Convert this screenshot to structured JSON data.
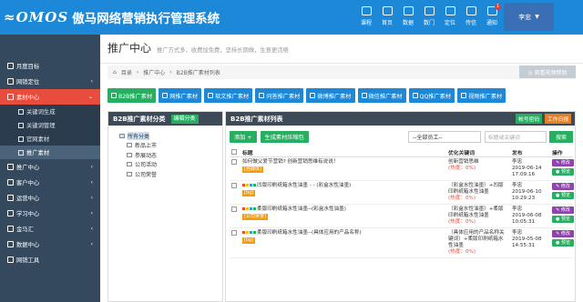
{
  "header": {
    "logo_text": "OMOS",
    "title": "傲马网络营销执行管理系统",
    "nav": [
      {
        "label": "课程",
        "badge": ""
      },
      {
        "label": "首页",
        "badge": ""
      },
      {
        "label": "数据",
        "badge": ""
      },
      {
        "label": "数门",
        "badge": ""
      },
      {
        "label": "定位",
        "badge": ""
      },
      {
        "label": "传信",
        "badge": ""
      },
      {
        "label": "通知",
        "badge": "1"
      }
    ],
    "user": "李忠"
  },
  "sidebar": {
    "items": [
      {
        "label": "月度目标",
        "arrow": ""
      },
      {
        "label": "网销定位",
        "arrow": "‹"
      },
      {
        "label": "素材中心",
        "arrow": "⌄",
        "active": true
      }
    ],
    "sub": [
      {
        "label": "关键词生成"
      },
      {
        "label": "关键词管理"
      },
      {
        "label": "官网素材"
      },
      {
        "label": "推广素材",
        "current": true
      }
    ],
    "rest": [
      {
        "label": "推广中心",
        "arrow": "‹"
      },
      {
        "label": "客户中心",
        "arrow": "‹"
      },
      {
        "label": "运营中心",
        "arrow": "‹"
      },
      {
        "label": "学习中心",
        "arrow": "‹"
      },
      {
        "label": "金马汇",
        "arrow": "‹"
      },
      {
        "label": "数据中心",
        "arrow": "‹"
      },
      {
        "label": "网销工具",
        "arrow": ""
      }
    ]
  },
  "page": {
    "title": "推广中心",
    "subtitle": "推广方式多，收费加免费，坚持长期做，生意更活络",
    "crumb": [
      "目录",
      "推广中心",
      "B2B推广素材列表"
    ],
    "help": "◎ 观看视频帮助"
  },
  "tabs": [
    "B2B推广素材",
    "网推广素材",
    "软文推广素材",
    "问答推广素材",
    "微博推广素材",
    "微信推广素材",
    "QQ推广素材",
    "视频推广素材"
  ],
  "category": {
    "title": "B2B推广素材分类",
    "edit": "编辑分类",
    "root": "所有分类",
    "children": [
      "新品上市",
      "参展动态",
      "公司活动",
      "公司荣誉"
    ]
  },
  "list": {
    "title": "B2B推广素材列表",
    "btn_account": "帐号密码",
    "btn_log": "工作日报",
    "add": "添加 +",
    "gen": "生成素材压缩包",
    "select": "--全部员工--",
    "kw_placeholder": "标题或关键词",
    "search": "搜索",
    "headers": [
      "标题",
      "优化关键词",
      "发布",
      "操作"
    ],
    "rows": [
      {
        "title": "如何做父爱节营销? 创新营销思维有说说！",
        "tag": "[自媒体]",
        "kw": "创新营销思维",
        "degree": "(热度：0%)",
        "author": "李忠",
        "date": "2019-06-14 17:09:16"
      },
      {
        "title": "凹版印刷纸箱水性油墨 - - (彩盒水性油墨)",
        "tag": "[bg]",
        "kw": "（彩盒水性油墨）+凹版印刷纸箱水性油墨",
        "degree": "(热度：0%)",
        "author": "李忠",
        "date": "2019-06-10 10:29:23"
      },
      {
        "title": "柔版印刷纸箱水性油墨--(彩盒水性油墨)",
        "tag": "[公司荣誉]",
        "kw": "（彩盒水性油墨）+柔版印刷纸箱水性油墨",
        "degree": "(热度：0%)",
        "author": "李忠",
        "date": "2019-06-08 10:05:31"
      },
      {
        "title": "柔版印刷纸箱水性油墨--(具体应用的产品名称)",
        "tag": "[bg]",
        "kw": "（具体应用的产品名称关键词）+柔版印刷纸箱水性油墨",
        "degree": "(热度：0%)",
        "author": "李忠",
        "date": "2019-05-08 14:55:31"
      }
    ],
    "act_edit": "✎ 修改",
    "act_view": "● 预览"
  }
}
